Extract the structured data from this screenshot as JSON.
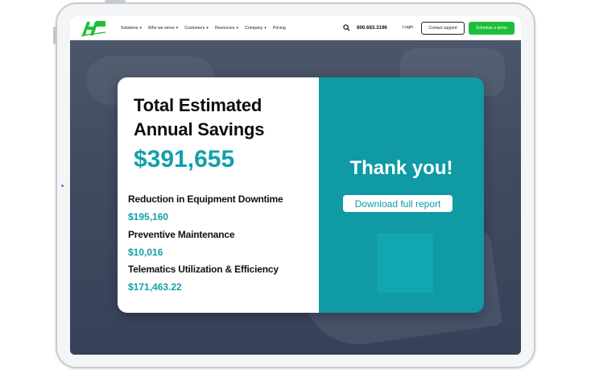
{
  "nav": {
    "phone": "800.683.3196",
    "login": "Login",
    "support_button": "Contact support",
    "demo_button": "Schedule a demo",
    "links": [
      {
        "label": "Solutions"
      },
      {
        "label": "Who we serve"
      },
      {
        "label": "Customers"
      },
      {
        "label": "Resources"
      },
      {
        "label": "Company"
      },
      {
        "label": "Pricing"
      }
    ],
    "chevron": "▾"
  },
  "card": {
    "title_line1": "Total Estimated",
    "title_line2": "Annual Savings",
    "total_value": "$391,655",
    "metrics": [
      {
        "label": "Reduction in Equipment Downtime",
        "value": "$195,160"
      },
      {
        "label": "Preventive Maintenance",
        "value": "$10,016"
      },
      {
        "label": "Telematics Utilization & Efficiency",
        "value": "$171,463.22"
      }
    ],
    "thanks": "Thank you!",
    "download_button": "Download full report"
  },
  "colors": {
    "accent_teal": "#0f9aa4",
    "value_teal": "#12a0a8",
    "demo_green": "#1dbf3a",
    "hero_bg": "#465165"
  }
}
